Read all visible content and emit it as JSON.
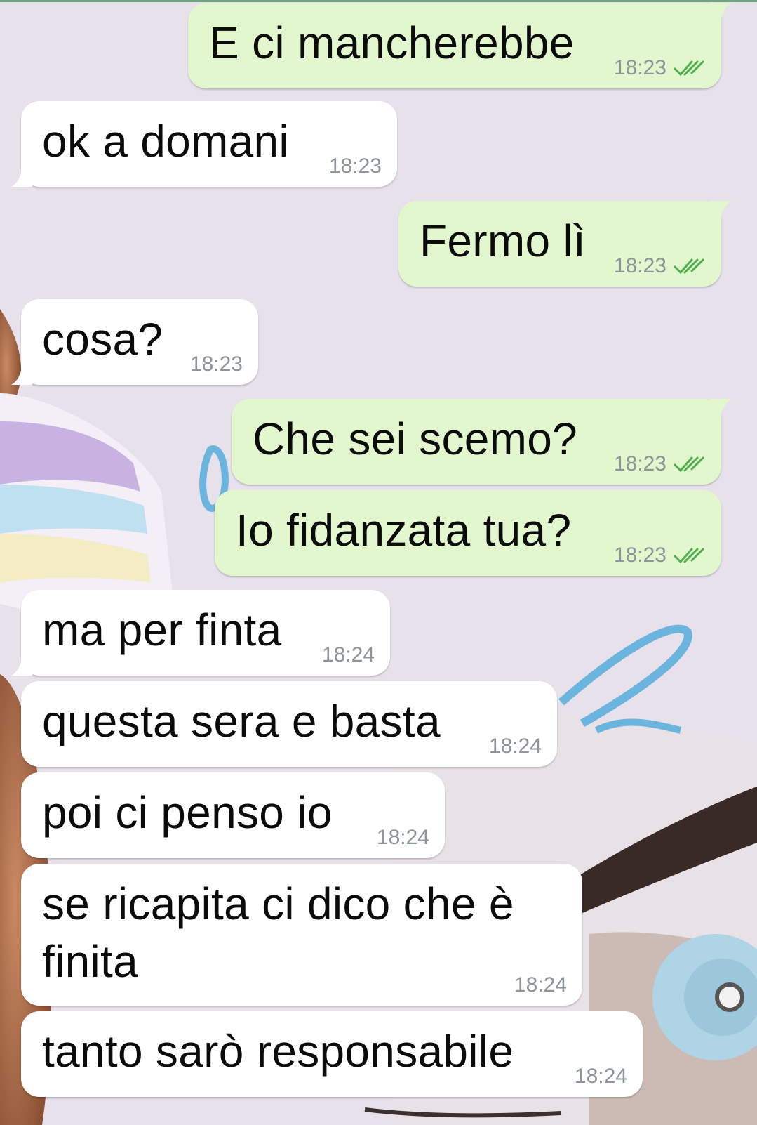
{
  "colors": {
    "outgoing_bubble": "#e3f7ce",
    "incoming_bubble": "#ffffff",
    "read_ticks": "#4fae4e",
    "timestamp": "#8d949a"
  },
  "messages": [
    {
      "direction": "out",
      "text": "E ci mancherebbe",
      "time": "18:23",
      "status": "read"
    },
    {
      "direction": "in",
      "text": "ok a domani",
      "time": "18:23"
    },
    {
      "direction": "out",
      "text": "Fermo lì",
      "time": "18:23",
      "status": "read"
    },
    {
      "direction": "in",
      "text": "cosa?",
      "time": "18:23"
    },
    {
      "direction": "out",
      "text": "Che sei scemo?",
      "time": "18:23",
      "status": "read"
    },
    {
      "direction": "out",
      "text": "Io fidanzata tua?",
      "time": "18:23",
      "status": "read"
    },
    {
      "direction": "in",
      "text": "ma per finta",
      "time": "18:24"
    },
    {
      "direction": "in",
      "text": "questa sera e basta",
      "time": "18:24"
    },
    {
      "direction": "in",
      "text": "poi ci penso io",
      "time": "18:24"
    },
    {
      "direction": "in",
      "text": "se ricapita ci dico che è finita",
      "time": "18:24"
    },
    {
      "direction": "in",
      "text": "tanto sarò responsabile",
      "time": "18:24"
    }
  ]
}
